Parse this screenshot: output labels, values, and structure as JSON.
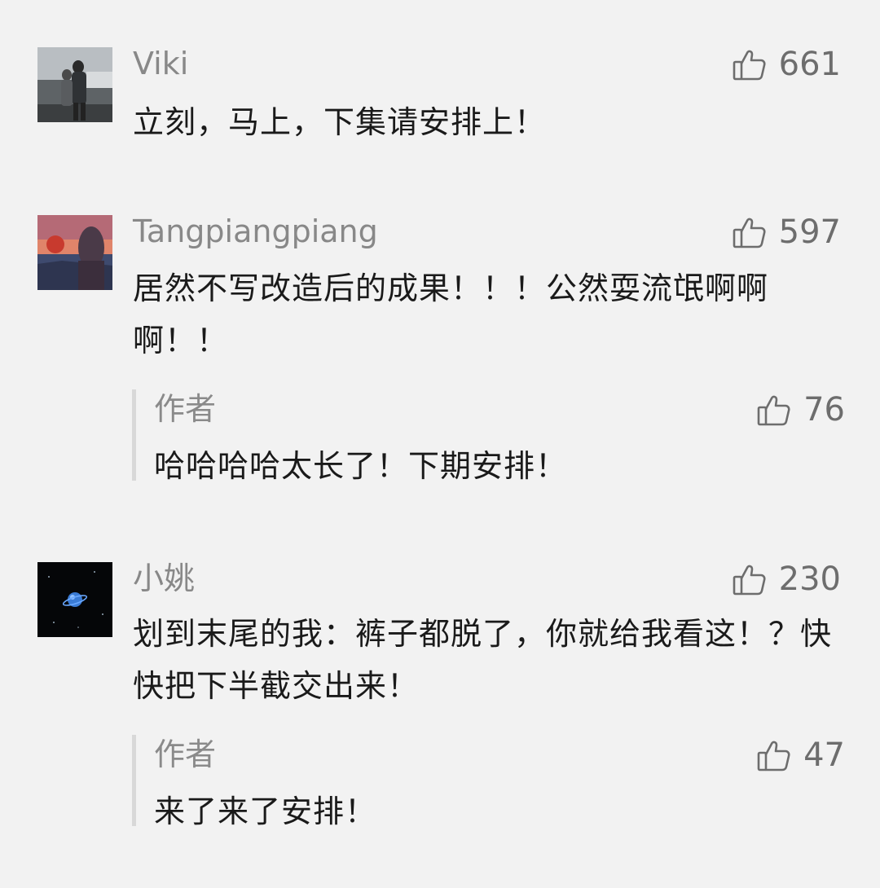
{
  "comments": [
    {
      "nickname": "Viki",
      "likes": "661",
      "text": "立刻，马上，下集请安排上！",
      "avatar": "person-photo-avatar"
    },
    {
      "nickname": "Tangpiangpiang",
      "likes": "597",
      "text": "居然不写改造后的成果！！！公然耍流氓啊啊啊！！",
      "avatar": "sunset-photo-avatar",
      "reply": {
        "nickname": "作者",
        "likes": "76",
        "text": "哈哈哈哈太长了！下期安排！"
      }
    },
    {
      "nickname": "小姚",
      "likes": "230",
      "text": "划到末尾的我：裤子都脱了，你就给我看这！？快快把下半截交出来！",
      "avatar": "planet-avatar",
      "reply": {
        "nickname": "作者",
        "likes": "47",
        "text": "来了来了安排！"
      }
    }
  ],
  "icons": {
    "like": "thumbs-up-icon"
  },
  "colors": {
    "background": "#f2f2f2",
    "nickname": "#888888",
    "text": "#1a1a1a",
    "like": "#6d6d6d",
    "reply_bar": "#d8d8d8"
  }
}
